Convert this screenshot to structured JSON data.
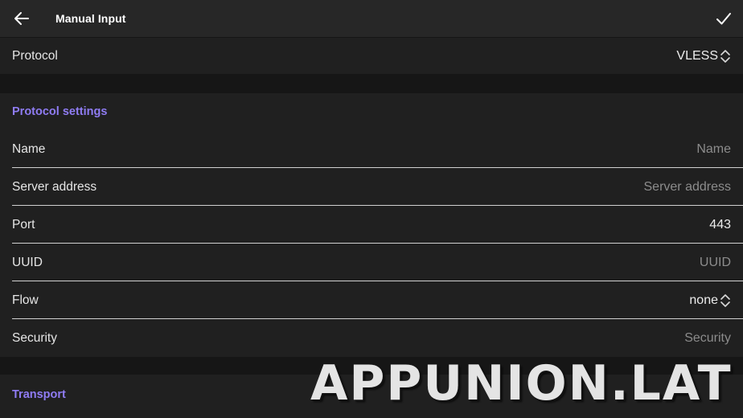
{
  "toolbar": {
    "title": "Manual Input",
    "back_icon": "arrow-left-icon",
    "confirm_icon": "check-icon"
  },
  "protocol": {
    "label": "Protocol",
    "value": "VLESS"
  },
  "protocol_settings": {
    "header": "Protocol settings",
    "fields": [
      {
        "label": "Name",
        "placeholder": "Name",
        "value": ""
      },
      {
        "label": "Server address",
        "placeholder": "Server address",
        "value": ""
      },
      {
        "label": "Port",
        "placeholder": "",
        "value": "443"
      },
      {
        "label": "UUID",
        "placeholder": "UUID",
        "value": ""
      },
      {
        "label": "Flow",
        "value": "none"
      },
      {
        "label": "Security",
        "placeholder": "Security",
        "value": ""
      }
    ]
  },
  "transport": {
    "header": "Transport"
  },
  "watermark": "APPUNION.LAT",
  "colors": {
    "accent": "#8f7cf3",
    "toolbar": "#272727",
    "card": "#202020",
    "background": "#161616"
  }
}
